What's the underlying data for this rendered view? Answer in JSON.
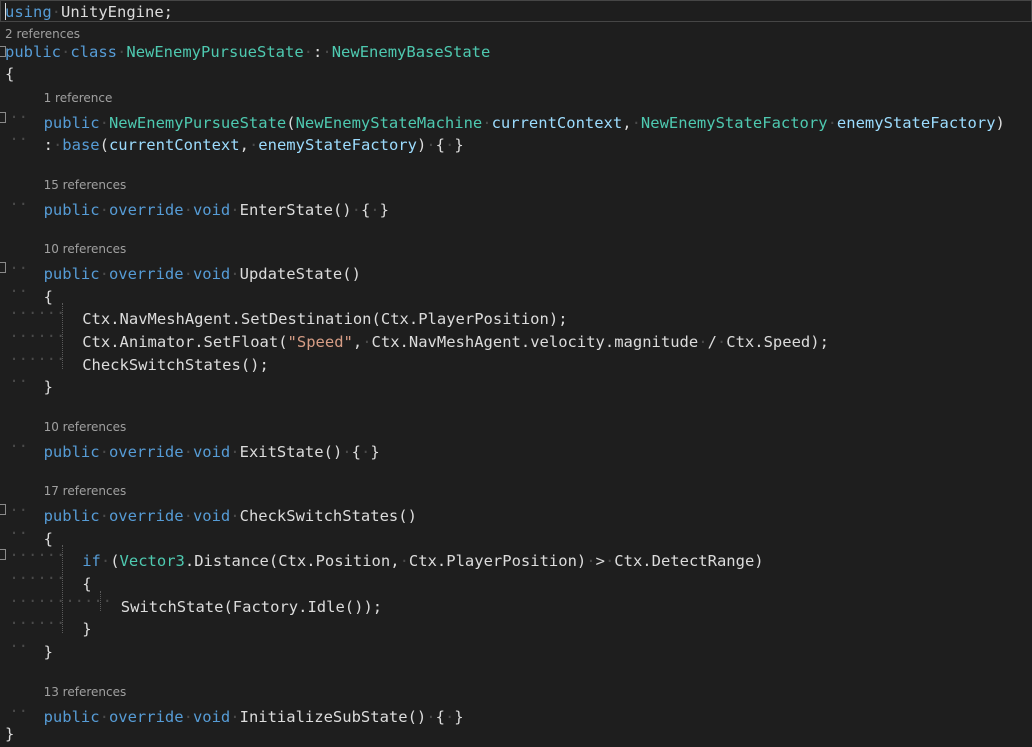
{
  "editor": {
    "language": "csharp",
    "colors": {
      "background": "#1e1e1e",
      "keyword": "#569cd6",
      "type": "#4ec9b0",
      "parameter": "#9cdcfe",
      "string": "#d69d85",
      "plain": "#dcdcdc",
      "codelens": "#a0a0a0"
    },
    "lines": [
      {
        "text": "using UnityEngine;"
      },
      {
        "codelens": "2 references",
        "text": "public class NewEnemyPursueState : NewEnemyBaseState"
      },
      {
        "text": "{"
      },
      {
        "codelens": "1 reference",
        "text": "public NewEnemyPursueState(NewEnemyStateMachine currentContext, NewEnemyStateFactory enemyStateFactory)"
      },
      {
        "text": ": base(currentContext, enemyStateFactory) { }"
      },
      {
        "codelens": "15 references",
        "text": "public override void EnterState() { }"
      },
      {
        "codelens": "10 references",
        "text": "public override void UpdateState()"
      },
      {
        "text": "{"
      },
      {
        "text": "Ctx.NavMeshAgent.SetDestination(Ctx.PlayerPosition);"
      },
      {
        "text": "Ctx.Animator.SetFloat(\"Speed\", Ctx.NavMeshAgent.velocity.magnitude / Ctx.Speed);"
      },
      {
        "text": "CheckSwitchStates();"
      },
      {
        "text": "}"
      },
      {
        "codelens": "10 references",
        "text": "public override void ExitState() { }"
      },
      {
        "codelens": "17 references",
        "text": "public override void CheckSwitchStates()"
      },
      {
        "text": "{"
      },
      {
        "text": "if (Vector3.Distance(Ctx.Position, Ctx.PlayerPosition) > Ctx.DetectRange)"
      },
      {
        "text": "{"
      },
      {
        "text": "SwitchState(Factory.Idle());"
      },
      {
        "text": "}"
      },
      {
        "text": "}"
      },
      {
        "codelens": "13 references",
        "text": "public override void InitializeSubState() { }"
      },
      {
        "text": "}"
      }
    ]
  }
}
